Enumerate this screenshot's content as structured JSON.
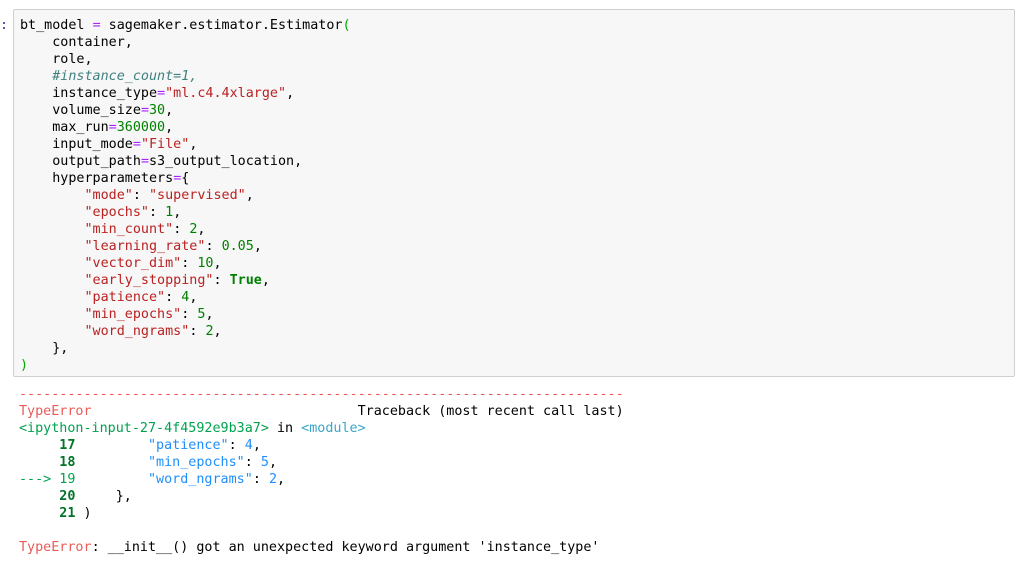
{
  "cell": {
    "prompt": ":",
    "code_lines": [
      [
        {
          "t": "bt_model ",
          "c": ""
        },
        {
          "t": "=",
          "c": "kw-op"
        },
        {
          "t": " sagemaker.estimator.Estimator",
          "c": ""
        },
        {
          "t": "(",
          "c": "paren-green"
        }
      ],
      [
        {
          "t": "    container,",
          "c": ""
        }
      ],
      [
        {
          "t": "    role,",
          "c": ""
        }
      ],
      [
        {
          "t": "    #instance_count=1,",
          "c": "cmt"
        }
      ],
      [
        {
          "t": "    instance_type",
          "c": ""
        },
        {
          "t": "=",
          "c": "kw-op"
        },
        {
          "t": "\"ml.c4.4xlarge\"",
          "c": "str"
        },
        {
          "t": ",",
          "c": ""
        }
      ],
      [
        {
          "t": "    volume_size",
          "c": ""
        },
        {
          "t": "=",
          "c": "kw-op"
        },
        {
          "t": "30",
          "c": "num"
        },
        {
          "t": ",",
          "c": ""
        }
      ],
      [
        {
          "t": "    max_run",
          "c": ""
        },
        {
          "t": "=",
          "c": "kw-op"
        },
        {
          "t": "360000",
          "c": "num"
        },
        {
          "t": ",",
          "c": ""
        }
      ],
      [
        {
          "t": "    input_mode",
          "c": ""
        },
        {
          "t": "=",
          "c": "kw-op"
        },
        {
          "t": "\"File\"",
          "c": "str"
        },
        {
          "t": ",",
          "c": ""
        }
      ],
      [
        {
          "t": "    output_path",
          "c": ""
        },
        {
          "t": "=",
          "c": "kw-op"
        },
        {
          "t": "s3_output_location,",
          "c": ""
        }
      ],
      [
        {
          "t": "    hyperparameters",
          "c": ""
        },
        {
          "t": "=",
          "c": "kw-op"
        },
        {
          "t": "{",
          "c": ""
        }
      ],
      [
        {
          "t": "        ",
          "c": ""
        },
        {
          "t": "\"mode\"",
          "c": "str"
        },
        {
          "t": ": ",
          "c": ""
        },
        {
          "t": "\"supervised\"",
          "c": "str"
        },
        {
          "t": ",",
          "c": ""
        }
      ],
      [
        {
          "t": "        ",
          "c": ""
        },
        {
          "t": "\"epochs\"",
          "c": "str"
        },
        {
          "t": ": ",
          "c": ""
        },
        {
          "t": "1",
          "c": "num"
        },
        {
          "t": ",",
          "c": ""
        }
      ],
      [
        {
          "t": "        ",
          "c": ""
        },
        {
          "t": "\"min_count\"",
          "c": "str"
        },
        {
          "t": ": ",
          "c": ""
        },
        {
          "t": "2",
          "c": "num"
        },
        {
          "t": ",",
          "c": ""
        }
      ],
      [
        {
          "t": "        ",
          "c": ""
        },
        {
          "t": "\"learning_rate\"",
          "c": "str"
        },
        {
          "t": ": ",
          "c": ""
        },
        {
          "t": "0.05",
          "c": "num"
        },
        {
          "t": ",",
          "c": ""
        }
      ],
      [
        {
          "t": "        ",
          "c": ""
        },
        {
          "t": "\"vector_dim\"",
          "c": "str"
        },
        {
          "t": ": ",
          "c": ""
        },
        {
          "t": "10",
          "c": "num"
        },
        {
          "t": ",",
          "c": ""
        }
      ],
      [
        {
          "t": "        ",
          "c": ""
        },
        {
          "t": "\"early_stopping\"",
          "c": "str"
        },
        {
          "t": ": ",
          "c": ""
        },
        {
          "t": "True",
          "c": "bool"
        },
        {
          "t": ",",
          "c": ""
        }
      ],
      [
        {
          "t": "        ",
          "c": ""
        },
        {
          "t": "\"patience\"",
          "c": "str"
        },
        {
          "t": ": ",
          "c": ""
        },
        {
          "t": "4",
          "c": "num"
        },
        {
          "t": ",",
          "c": ""
        }
      ],
      [
        {
          "t": "        ",
          "c": ""
        },
        {
          "t": "\"min_epochs\"",
          "c": "str"
        },
        {
          "t": ": ",
          "c": ""
        },
        {
          "t": "5",
          "c": "num"
        },
        {
          "t": ",",
          "c": ""
        }
      ],
      [
        {
          "t": "        ",
          "c": ""
        },
        {
          "t": "\"word_ngrams\"",
          "c": "str"
        },
        {
          "t": ": ",
          "c": ""
        },
        {
          "t": "2",
          "c": "num"
        },
        {
          "t": ",",
          "c": ""
        }
      ],
      [
        {
          "t": "    },",
          "c": ""
        }
      ],
      [
        {
          "t": ")",
          "c": "paren-green"
        }
      ]
    ]
  },
  "output": {
    "lines": [
      [
        {
          "t": "---------------------------------------------------------------------------",
          "c": "dashes"
        }
      ],
      [
        {
          "t": "TypeError",
          "c": "red"
        },
        {
          "t": "                                 Traceback (most recent call last)",
          "c": ""
        }
      ],
      [
        {
          "t": "<ipython-input-27-4f4592e9b3a7>",
          "c": "green-tb"
        },
        {
          "t": " in ",
          "c": ""
        },
        {
          "t": "<module>",
          "c": "cyan-tb"
        }
      ],
      [
        {
          "t": "     17",
          "c": "bold-green"
        },
        {
          "t": "         ",
          "c": ""
        },
        {
          "t": "\"patience\"",
          "c": "blue-tb"
        },
        {
          "t": ": ",
          "c": ""
        },
        {
          "t": "4",
          "c": "blue-tb"
        },
        {
          "t": ",",
          "c": ""
        }
      ],
      [
        {
          "t": "     18",
          "c": "bold-green"
        },
        {
          "t": "         ",
          "c": ""
        },
        {
          "t": "\"min_epochs\"",
          "c": "blue-tb"
        },
        {
          "t": ": ",
          "c": ""
        },
        {
          "t": "5",
          "c": "blue-tb"
        },
        {
          "t": ",",
          "c": ""
        }
      ],
      [
        {
          "t": "---> 19",
          "c": "green-tb"
        },
        {
          "t": "         ",
          "c": ""
        },
        {
          "t": "\"word_ngrams\"",
          "c": "blue-tb"
        },
        {
          "t": ": ",
          "c": ""
        },
        {
          "t": "2",
          "c": "blue-tb"
        },
        {
          "t": ",",
          "c": ""
        }
      ],
      [
        {
          "t": "     20",
          "c": "bold-green"
        },
        {
          "t": "     },",
          "c": ""
        }
      ],
      [
        {
          "t": "     21",
          "c": "bold-green"
        },
        {
          "t": " )",
          "c": ""
        }
      ],
      [
        {
          "t": "",
          "c": ""
        }
      ],
      [
        {
          "t": "TypeError",
          "c": "red"
        },
        {
          "t": ": __init__() got an unexpected keyword argument 'instance_type'",
          "c": ""
        }
      ]
    ]
  }
}
